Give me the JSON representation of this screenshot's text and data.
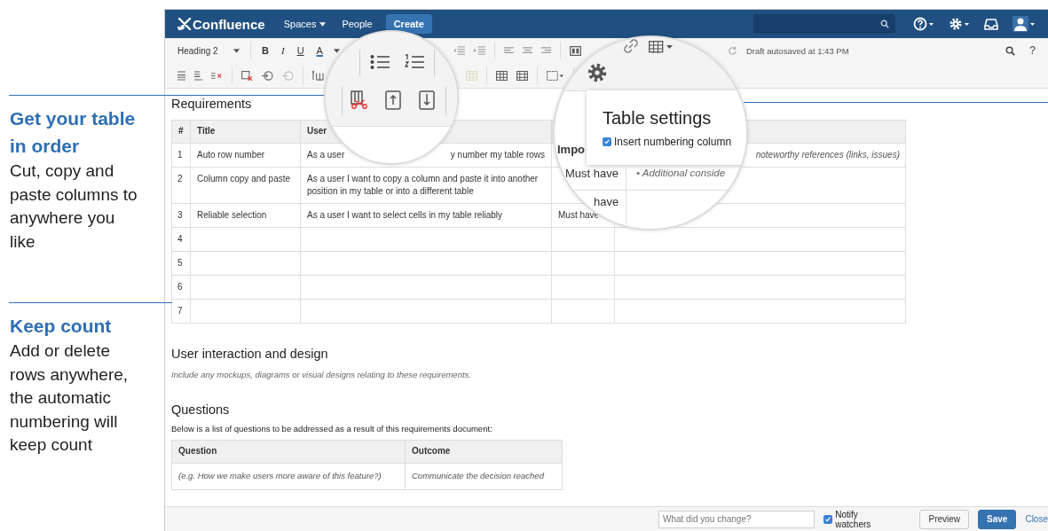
{
  "callouts": [
    {
      "title": "Get your table in order",
      "body": "Cut, copy and paste columns to anywhere you like"
    },
    {
      "title": "Keep count",
      "body": "Add or delete rows anywhere, the automatic numbering will keep count"
    }
  ],
  "nav": {
    "logo": "Confluence",
    "items": [
      {
        "label": "Spaces",
        "dropdown": true
      },
      {
        "label": "People",
        "dropdown": false
      }
    ],
    "create": "Create"
  },
  "toolbar": {
    "style": "Heading 2",
    "format_buttons": [
      "B",
      "I",
      "U",
      "A"
    ],
    "status": "Draft autosaved at 1:43 PM",
    "help": "?"
  },
  "magnifier": {
    "popup": {
      "title": "Table settings",
      "option": {
        "label": "Insert numbering column",
        "checked": true
      }
    },
    "header": "Impo",
    "cells": [
      "Must have",
      "have"
    ],
    "note": "• Additional conside"
  },
  "requirements": {
    "heading": "Requirements",
    "columns": [
      "#",
      "Title",
      "User"
    ],
    "rows": [
      {
        "number": "1",
        "title": "Auto row number",
        "story": [
          "As a user",
          "y number my table rows"
        ],
        "notes": "noteworthy references (links, issues)"
      },
      {
        "number": "2",
        "title": "Column copy and paste",
        "story": [
          "As a user I want to copy a column and paste it into another position in my table or into a different table"
        ]
      },
      {
        "number": "3",
        "title": "Reliable selection",
        "story": [
          "As a user I want to select cells in my table reliably"
        ],
        "importance": "Must have"
      },
      {
        "number": "4"
      },
      {
        "number": "5"
      },
      {
        "number": "6"
      },
      {
        "number": "7"
      }
    ]
  },
  "design": {
    "heading": "User interaction and design",
    "hint": "Include any mockups, diagrams or visual designs relating to these requirements."
  },
  "questions": {
    "heading": "Questions",
    "intro": "Below is a list of questions to be addressed as a result of this requirements document:",
    "columns": [
      "Question",
      "Outcome"
    ],
    "rows": [
      [
        "(e.g. How we make users more aware of this feature?)",
        "Communicate the decision reached"
      ]
    ]
  },
  "footer": {
    "placeholder": "What did you change?",
    "notify": {
      "label": "Notify watchers",
      "checked": true
    },
    "buttons": [
      {
        "label": "Preview",
        "kind": "secondary"
      },
      {
        "label": "Save",
        "kind": "primary"
      },
      {
        "label": "Close",
        "kind": "link"
      }
    ]
  }
}
